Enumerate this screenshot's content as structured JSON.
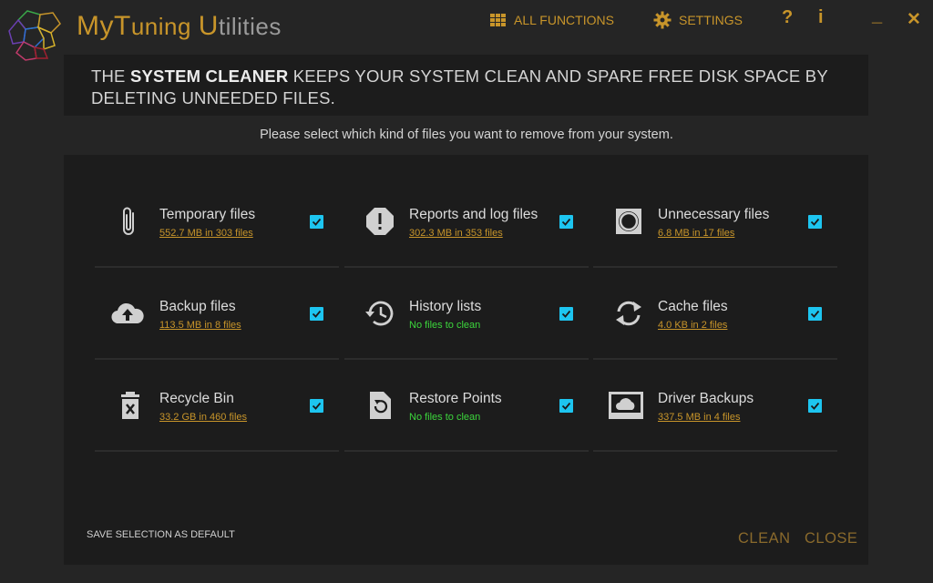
{
  "app": {
    "title_my": "My",
    "title_t": "T",
    "title_uning": "uning",
    "title_u": "U",
    "title_tilities": "tilities"
  },
  "menu": {
    "all_functions": "ALL FUNCTIONS",
    "settings": "SETTINGS",
    "help": "?",
    "info": "i",
    "minimize": "_",
    "close": "✕"
  },
  "header": {
    "text_pre": "THE ",
    "text_bold": "SYSTEM CLEANER",
    "text_post": " KEEPS YOUR SYSTEM CLEAN AND SPARE FREE DISK SPACE BY DELETING UNNEEDED FILES."
  },
  "instruction": "Please select which kind of files you want to remove from your system.",
  "categories": [
    {
      "name": "Temporary files",
      "detail": "552.7 MB in 303 files",
      "icon": "paperclip-icon",
      "checked": true
    },
    {
      "name": "Reports and log files",
      "detail": "302.3 MB in 353 files",
      "icon": "alert-octagon-icon",
      "checked": true
    },
    {
      "name": "Unnecessary files",
      "detail": "6.8 MB in 17 files",
      "icon": "circle-frame-icon",
      "checked": true
    },
    {
      "name": "Backup files",
      "detail": "113.5 MB in 8 files",
      "icon": "cloud-upload-icon",
      "checked": true
    },
    {
      "name": "History lists",
      "detail": "No files to clean",
      "icon": "history-icon",
      "checked": true
    },
    {
      "name": "Cache files",
      "detail": "4.0 KB in 2 files",
      "icon": "refresh-icon",
      "checked": true
    },
    {
      "name": "Recycle Bin",
      "detail": "33.2 GB in 460 files",
      "icon": "trash-icon",
      "checked": true
    },
    {
      "name": "Restore Points",
      "detail": "No files to clean",
      "icon": "restore-file-icon",
      "checked": true
    },
    {
      "name": "Driver Backups",
      "detail": "337.5 MB in 4 files",
      "icon": "cloud-drive-icon",
      "checked": true
    }
  ],
  "footer": {
    "save_default": "SAVE SELECTION AS DEFAULT",
    "clean": "CLEAN",
    "close": "CLOSE"
  },
  "colors": {
    "accent": "#c8952a",
    "checkbox": "#1dc5f0",
    "no_files": "#3cd63c",
    "background": "#252525",
    "panel": "#1c1c1c"
  }
}
